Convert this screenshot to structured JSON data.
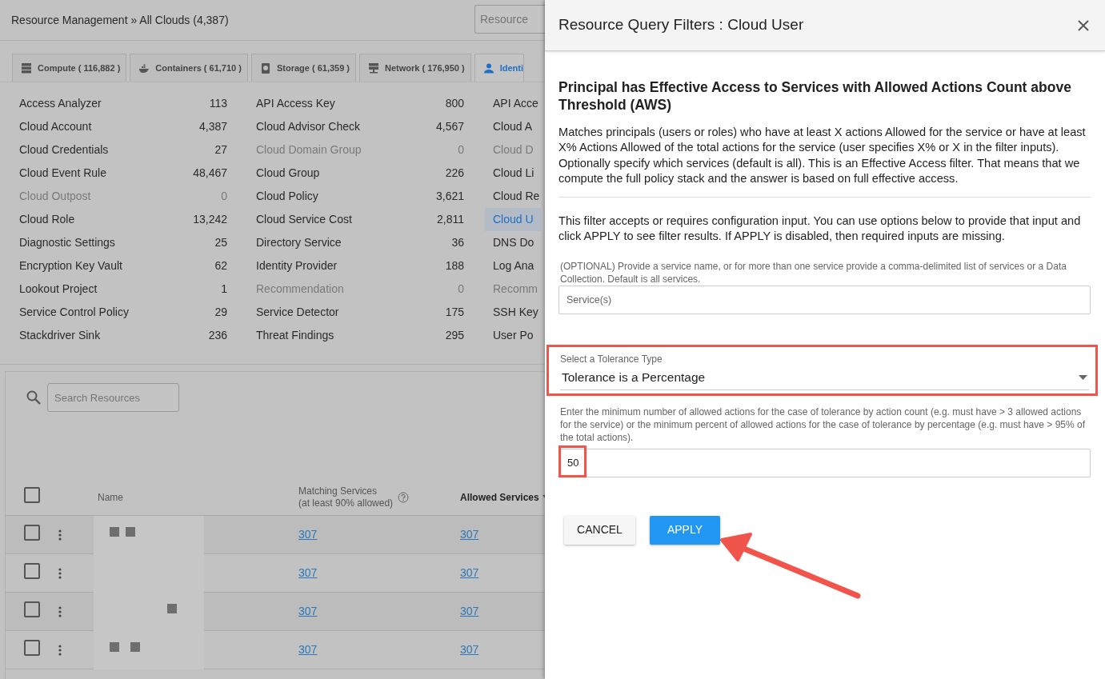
{
  "header": {
    "breadcrumb": "Resource Management » All Clouds (4,387)",
    "search_placeholder": "Resource"
  },
  "tabs": [
    {
      "label": "Compute ( 116,882 )",
      "kind": "server",
      "selected": false
    },
    {
      "label": "Containers ( 61,710 )",
      "kind": "whale",
      "selected": false
    },
    {
      "label": "Storage ( 61,359 )",
      "kind": "disk",
      "selected": false
    },
    {
      "label": "Network ( 176,950 )",
      "kind": "network",
      "selected": false
    },
    {
      "label": "Identi",
      "kind": "person",
      "selected": true
    }
  ],
  "resource_columns": [
    [
      {
        "name": "Access Analyzer",
        "count": "113",
        "disabled": false,
        "selected": false
      },
      {
        "name": "Cloud Account",
        "count": "4,387",
        "disabled": false,
        "selected": false
      },
      {
        "name": "Cloud Credentials",
        "count": "27",
        "disabled": false,
        "selected": false
      },
      {
        "name": "Cloud Event Rule",
        "count": "48,467",
        "disabled": false,
        "selected": false
      },
      {
        "name": "Cloud Outpost",
        "count": "0",
        "disabled": true,
        "selected": false
      },
      {
        "name": "Cloud Role",
        "count": "13,242",
        "disabled": false,
        "selected": false
      },
      {
        "name": "Diagnostic Settings",
        "count": "25",
        "disabled": false,
        "selected": false
      },
      {
        "name": "Encryption Key Vault",
        "count": "62",
        "disabled": false,
        "selected": false
      },
      {
        "name": "Lookout Project",
        "count": "1",
        "disabled": false,
        "selected": false
      },
      {
        "name": "Service Control Policy",
        "count": "29",
        "disabled": false,
        "selected": false
      },
      {
        "name": "Stackdriver Sink",
        "count": "236",
        "disabled": false,
        "selected": false
      }
    ],
    [
      {
        "name": "API Access Key",
        "count": "800",
        "disabled": false,
        "selected": false
      },
      {
        "name": "Cloud Advisor Check",
        "count": "4,567",
        "disabled": false,
        "selected": false
      },
      {
        "name": "Cloud Domain Group",
        "count": "0",
        "disabled": true,
        "selected": false
      },
      {
        "name": "Cloud Group",
        "count": "226",
        "disabled": false,
        "selected": false
      },
      {
        "name": "Cloud Policy",
        "count": "3,621",
        "disabled": false,
        "selected": false
      },
      {
        "name": "Cloud Service Cost",
        "count": "2,811",
        "disabled": false,
        "selected": false
      },
      {
        "name": "Directory Service",
        "count": "36",
        "disabled": false,
        "selected": false
      },
      {
        "name": "Identity Provider",
        "count": "188",
        "disabled": false,
        "selected": false
      },
      {
        "name": "Recommendation",
        "count": "0",
        "disabled": true,
        "selected": false
      },
      {
        "name": "Service Detector",
        "count": "175",
        "disabled": false,
        "selected": false
      },
      {
        "name": "Threat Findings",
        "count": "295",
        "disabled": false,
        "selected": false
      }
    ],
    [
      {
        "name": "API Acce",
        "disabled": false,
        "selected": false
      },
      {
        "name": "Cloud A",
        "disabled": false,
        "selected": false
      },
      {
        "name": "Cloud D",
        "disabled": true,
        "selected": false
      },
      {
        "name": "Cloud Li",
        "disabled": false,
        "selected": false
      },
      {
        "name": "Cloud Re",
        "disabled": false,
        "selected": false
      },
      {
        "name": "Cloud U",
        "disabled": false,
        "selected": true
      },
      {
        "name": "DNS Do",
        "disabled": false,
        "selected": false
      },
      {
        "name": "Log Ana",
        "disabled": false,
        "selected": false
      },
      {
        "name": "Recomm",
        "disabled": true,
        "selected": false
      },
      {
        "name": "SSH Key",
        "disabled": false,
        "selected": false
      },
      {
        "name": "User Po",
        "disabled": false,
        "selected": false
      }
    ]
  ],
  "search": {
    "placeholder": "Search Resources"
  },
  "table": {
    "select_all_checked": false,
    "columns": [
      {
        "label": "Name",
        "sorted": false
      },
      {
        "label": "Matching Services",
        "sublabel": "(at least 90% allowed)",
        "help": true,
        "sorted": false
      },
      {
        "label": "Allowed Services",
        "sorted": true
      }
    ],
    "rows": [
      {
        "checked": false,
        "matching": "307",
        "allowed": "307"
      },
      {
        "checked": false,
        "matching": "307",
        "allowed": "307"
      },
      {
        "checked": false,
        "matching": "307",
        "allowed": "307"
      },
      {
        "checked": false,
        "matching": "307",
        "allowed": "307"
      }
    ]
  },
  "drawer": {
    "title": "Resource Query Filters : Cloud User",
    "heading": "Principal has Effective Access to Services with Allowed Actions Count above Threshold (AWS)",
    "description": "Matches principals (users or roles) who have at least X actions Allowed for the service or have at least X% Actions Allowed of the total actions for the service (user specifies X% or X in the filter inputs). Optionally specify which services (default is all). This is an Effective Access filter. That means that we compute the full policy stack and the answer is based on full effective access.",
    "info": "This filter accepts or requires configuration input. You can use options below to provide that input and click APPLY to see filter results. If APPLY is disabled, then required inputs are missing.",
    "services": {
      "label": "(OPTIONAL) Provide a service name, or for more than one service provide a comma-delimited list of services or a Data Collection. Default is all services.",
      "placeholder": "Service(s)"
    },
    "tolerance": {
      "label": "Select a Tolerance Type",
      "value": "Tolerance is a Percentage",
      "highlighted": true
    },
    "threshold": {
      "label": "Enter the minimum number of allowed actions for the case of tolerance by action count (e.g. must have > 3 allowed actions for the service) or the minimum percent of allowed actions for the case of tolerance by percentage (e.g. must have > 95% of the total actions).",
      "value": "50",
      "highlighted": true
    },
    "buttons": [
      {
        "label": "CANCEL",
        "kind": "secondary"
      },
      {
        "label": "APPLY",
        "kind": "primary"
      }
    ],
    "arrow_to_apply": true
  }
}
